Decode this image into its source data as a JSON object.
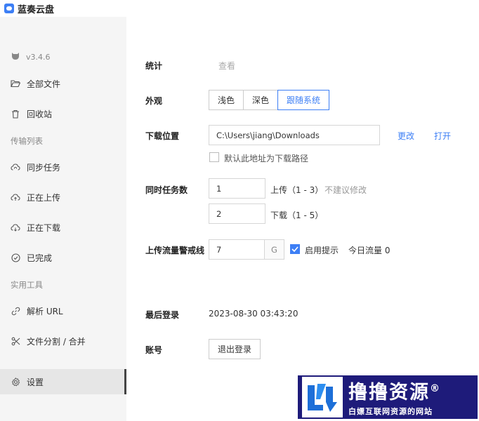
{
  "app": {
    "title": "蓝奏云盘"
  },
  "sidebar": {
    "version": "v3.4.6",
    "groups": {
      "transfer": "传输列表",
      "tools": "实用工具"
    },
    "items": [
      {
        "label": "全部文件",
        "icon": "folder-open-icon"
      },
      {
        "label": "回收站",
        "icon": "trash-icon"
      },
      {
        "label": "同步任务",
        "icon": "cloud-sync-icon"
      },
      {
        "label": "正在上传",
        "icon": "cloud-upload-icon"
      },
      {
        "label": "正在下载",
        "icon": "cloud-download-icon"
      },
      {
        "label": "已完成",
        "icon": "check-circle-icon"
      },
      {
        "label": "解析 URL",
        "icon": "link-icon"
      },
      {
        "label": "文件分割 / 合并",
        "icon": "scissors-icon"
      },
      {
        "label": "设置",
        "icon": "gear-icon"
      }
    ]
  },
  "settings": {
    "stats": {
      "label": "统计",
      "action": "查看"
    },
    "appearance": {
      "label": "外观",
      "options": [
        "浅色",
        "深色",
        "跟随系统"
      ],
      "selected": "跟随系统"
    },
    "download": {
      "label": "下载位置",
      "path": "C:\\Users\\jiang\\Downloads",
      "change": "更改",
      "open": "打开",
      "default_checkbox": "默认此地址为下载路径"
    },
    "tasks": {
      "label": "同时任务数",
      "upload_value": "1",
      "upload_text": "上传（1 - 3）",
      "upload_hint": "不建议修改",
      "download_value": "2",
      "download_text": "下载（1 - 5）"
    },
    "traffic": {
      "label": "上传流量警戒线",
      "value": "7",
      "unit": "G",
      "enable_label": "启用提示",
      "today": "今日流量 0"
    },
    "last_login": {
      "label": "最后登录",
      "value": "2023-08-30 03:43:20"
    },
    "account": {
      "label": "账号",
      "logout": "退出登录"
    }
  },
  "watermark": {
    "title": "撸撸资源",
    "mark": "®",
    "subtitle": "白嫖互联网资源的网站"
  }
}
